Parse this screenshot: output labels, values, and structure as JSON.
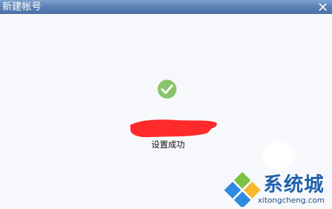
{
  "window": {
    "title": "新建帐号"
  },
  "dialog": {
    "status_text": "设置成功",
    "icons": {
      "close": "close-icon",
      "success": "checkmark-icon"
    }
  },
  "watermark": {
    "brand": "系统城",
    "url": "xitongcheng.com"
  },
  "colors": {
    "titlebar": "#5d83b8",
    "success_green": "#8bc36b",
    "redaction_red": "#ff2a2a",
    "watermark_blue": "#1f63ad"
  }
}
